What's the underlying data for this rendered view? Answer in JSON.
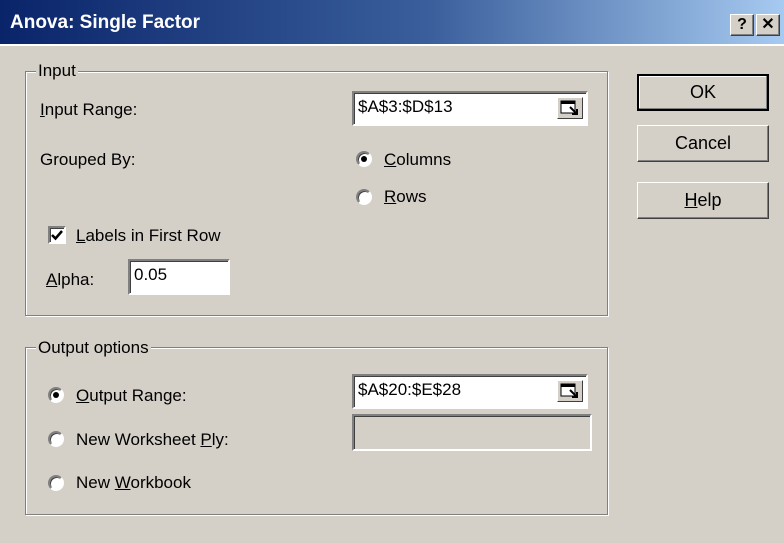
{
  "window": {
    "title": "Anova: Single Factor",
    "help_glyph": "?",
    "close_glyph": "✕"
  },
  "input_group": {
    "legend": "Input",
    "input_range": {
      "label_key": "I",
      "label_rest": "nput Range:",
      "value": "$A$3:$D$13"
    },
    "grouped_by": {
      "label": "Grouped By:",
      "options": [
        {
          "key": "C",
          "rest": "olumns",
          "selected": true
        },
        {
          "key": "R",
          "rest": "ows",
          "selected": false
        }
      ]
    },
    "labels_first_row": {
      "key": "L",
      "rest": "abels in First Row",
      "checked": true
    },
    "alpha": {
      "label_key": "A",
      "label_rest": "lpha:",
      "value": "0.05"
    }
  },
  "output_group": {
    "legend": "Output options",
    "output_range": {
      "key": "O",
      "rest": "utput Range:",
      "value": "$A$20:$E$28",
      "selected": true
    },
    "new_worksheet": {
      "before": "New Worksheet ",
      "key": "P",
      "rest": "ly:",
      "value": "",
      "selected": false
    },
    "new_workbook": {
      "before": "New ",
      "key": "W",
      "rest": "orkbook",
      "selected": false
    }
  },
  "buttons": {
    "ok": "OK",
    "cancel": "Cancel",
    "help_key": "H",
    "help_rest": "elp"
  }
}
